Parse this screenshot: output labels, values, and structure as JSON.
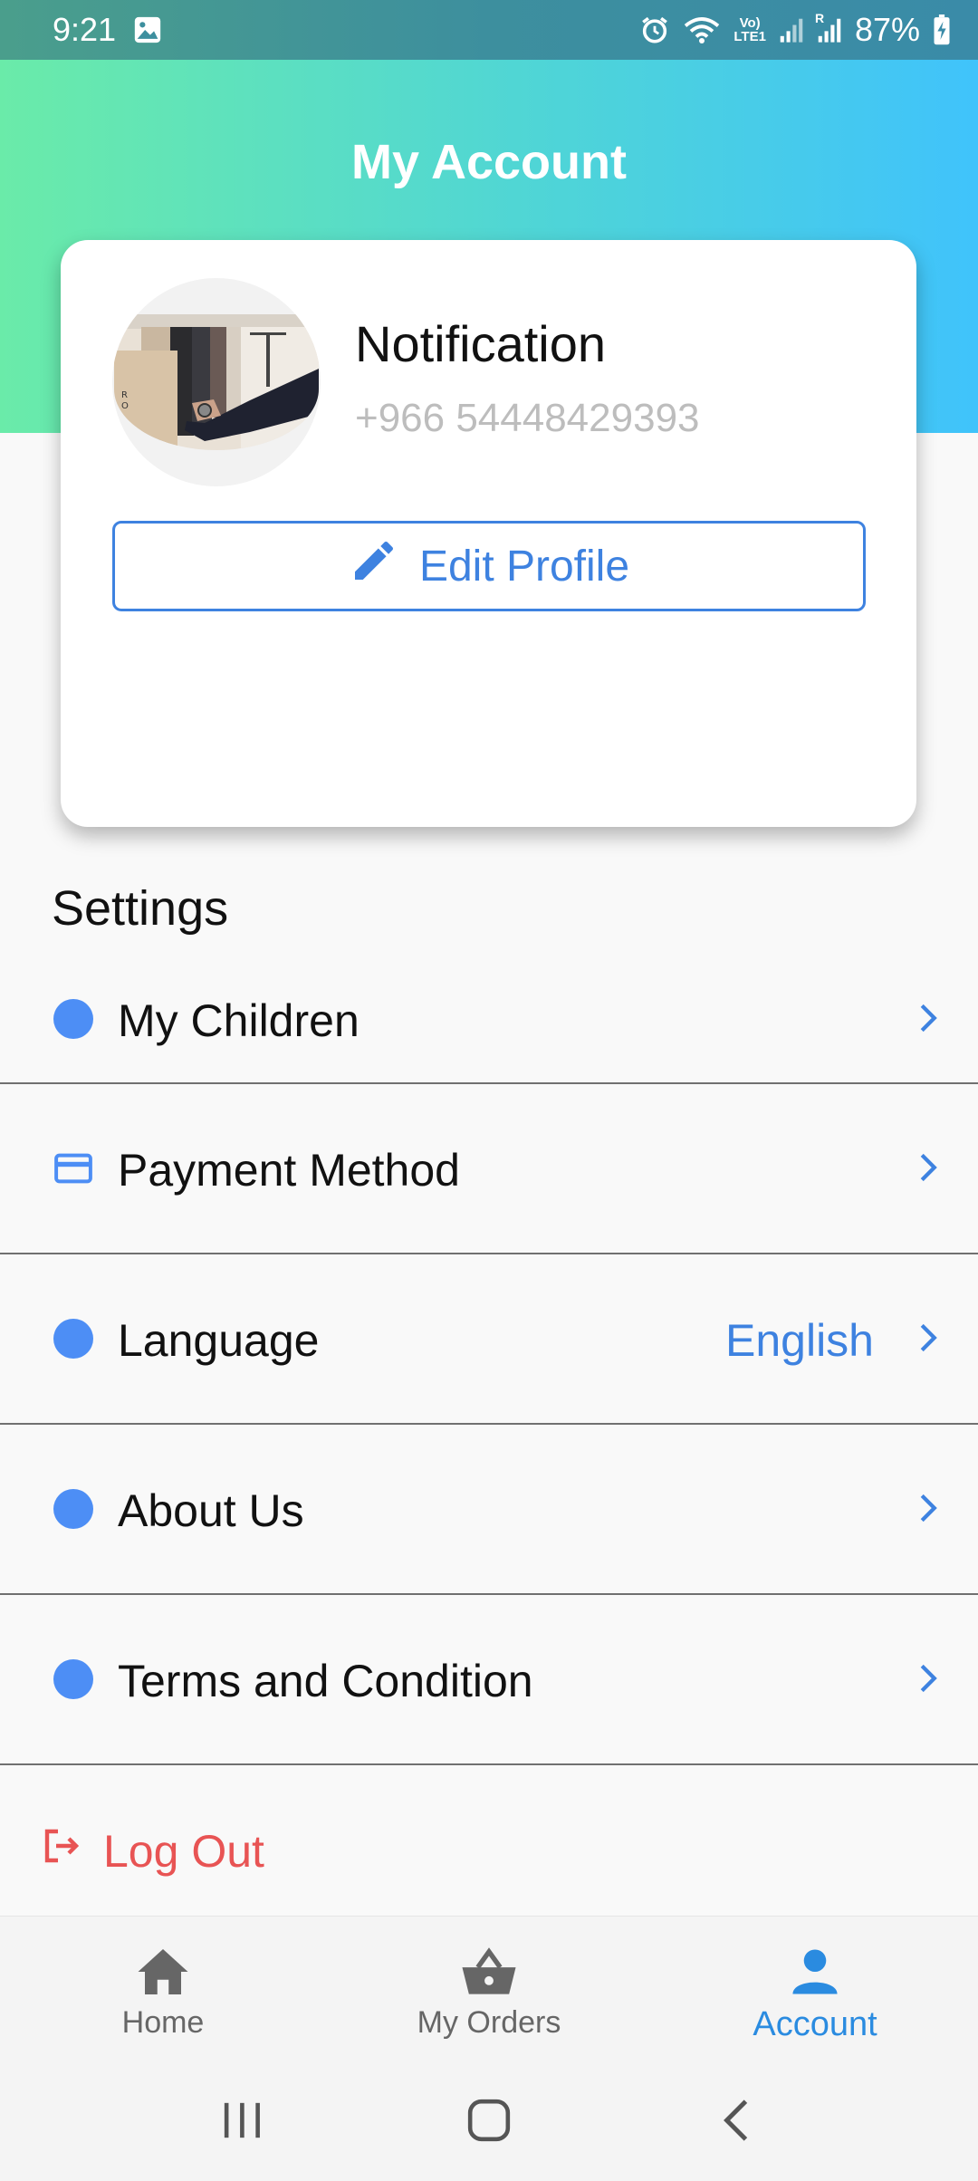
{
  "status_bar": {
    "time": "9:21",
    "battery": "87%",
    "network_label_top": "Vo)",
    "network_label_bottom": "LTE1",
    "signal_label": "R"
  },
  "header": {
    "title": "My Account"
  },
  "profile": {
    "name": "Notification",
    "phone": "+966 54448429393",
    "edit_label": "Edit Profile"
  },
  "settings": {
    "title": "Settings",
    "items": [
      {
        "label": "My Children",
        "icon": "dot-icon",
        "value": ""
      },
      {
        "label": "Payment Method",
        "icon": "credit-card-icon",
        "value": ""
      },
      {
        "label": "Language",
        "icon": "dot-icon",
        "value": "English"
      },
      {
        "label": "About Us",
        "icon": "dot-icon",
        "value": ""
      },
      {
        "label": "Terms and Condition",
        "icon": "dot-icon",
        "value": ""
      }
    ]
  },
  "logout": {
    "label": "Log Out"
  },
  "bottom_nav": {
    "items": [
      {
        "label": "Home",
        "icon": "home-icon",
        "active": false
      },
      {
        "label": "My Orders",
        "icon": "basket-icon",
        "active": false
      },
      {
        "label": "Account",
        "icon": "person-icon",
        "active": true
      }
    ]
  },
  "colors": {
    "accent": "#3e82e0",
    "dot": "#4d8ef5",
    "logout": "#e85454",
    "active_nav": "#2a8be0",
    "header_gradient_start": "#6aeba9",
    "header_gradient_end": "#40c3fb"
  }
}
